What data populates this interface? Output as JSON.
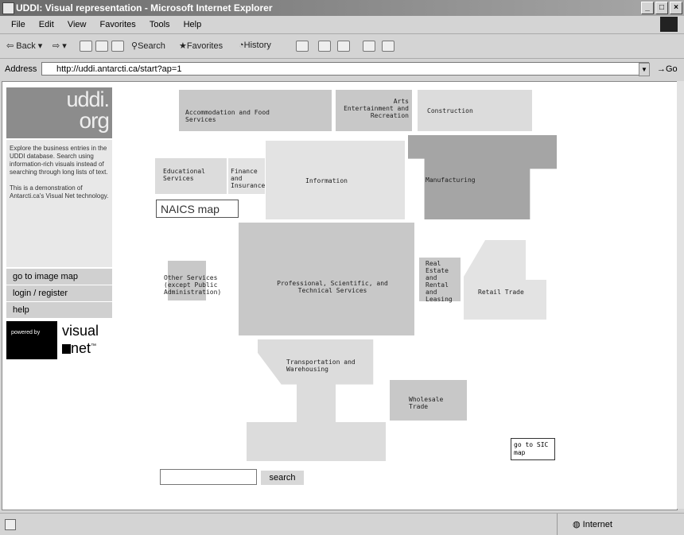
{
  "window": {
    "title": "UDDI: Visual representation - Microsoft Internet Explorer"
  },
  "menu": [
    "File",
    "Edit",
    "View",
    "Favorites",
    "Tools",
    "Help"
  ],
  "toolbar": {
    "back": "Back",
    "search": "Search",
    "favorites": "Favorites",
    "history": "History"
  },
  "address": {
    "label": "Address",
    "url": "http://uddi.antarcti.ca/start?ap=1",
    "go": "Go"
  },
  "sidebar": {
    "logo_top": "uddi.",
    "logo_bottom": "org",
    "intro": "Explore the business entries in the UDDI database. Search using information-rich visuals instead of searching through long lists of text.",
    "demo": "This is a demonstration of Antarcti.ca's Visual Net technology.",
    "buttons": [
      "go to image map",
      "login / register",
      "help"
    ],
    "powered": "powered by",
    "brand_top": "visual",
    "brand_bottom": "net"
  },
  "map": {
    "categories": [
      "Accommodation and Food Services",
      "Arts Entertainment and Recreation",
      "Construction",
      "Educational Services",
      "Finance and Insurance",
      "Information",
      "Manufacturing",
      "Other Services (except Public Administration)",
      "Professional, Scientific, and Technical Services",
      "Real Estate and Rental and Leasing",
      "Retail Trade",
      "Transportation and Warehousing",
      "Wholesale Trade"
    ],
    "naics_button": "NAICS map",
    "sic_button": "go to SIC map"
  },
  "search": {
    "button": "search",
    "value": ""
  },
  "status": {
    "zone": "Internet"
  }
}
